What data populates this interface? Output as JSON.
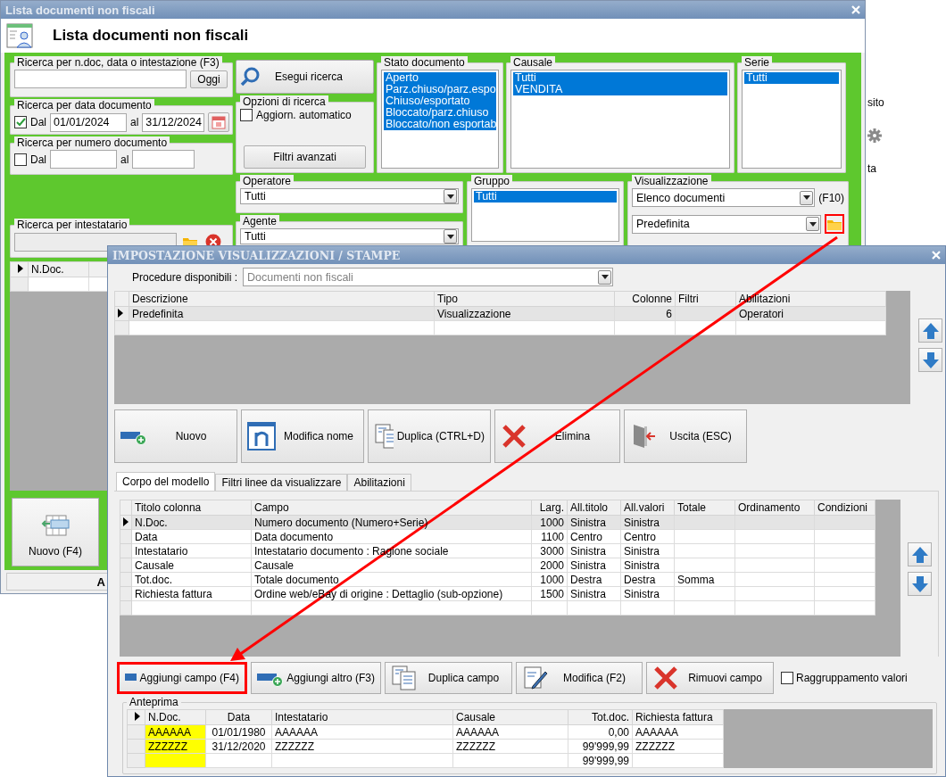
{
  "main_window": {
    "title": "Lista documenti non fiscali",
    "heading": "Lista documenti non fiscali",
    "quick_search": {
      "label": "Ricerca per n.doc, data o intestazione (F3)",
      "button": "Oggi"
    },
    "date_search": {
      "label": "Ricerca per data documento",
      "checkbox_label": "Dal",
      "checked": true,
      "from": "01/01/2024",
      "to_label": "al",
      "to": "31/12/2024"
    },
    "number_search": {
      "label": "Ricerca per numero documento",
      "checkbox_label": "Dal",
      "checked": false,
      "to_label": "al"
    },
    "holder_search": {
      "label": "Ricerca per intestatario"
    },
    "grid": {
      "columns": [
        "N.Doc."
      ]
    },
    "new_button": "Nuovo (F4)",
    "status_bar": "A",
    "run_search_button": "Esegui ricerca",
    "search_options": {
      "label": "Opzioni di ricerca",
      "auto_update_label": "Aggiorn. automatico",
      "auto_update": false,
      "advanced_button": "Filtri avanzati"
    },
    "lists": [
      {
        "label": "Stato documento",
        "items": [
          {
            "label": "Aperto",
            "selected": true
          },
          {
            "label": "Parz.chiuso/parz.espo",
            "selected": true
          },
          {
            "label": "Chiuso/esportato",
            "selected": true
          },
          {
            "label": "Bloccato/parz.chiuso",
            "selected": true
          },
          {
            "label": "Bloccato/non esportab",
            "selected": true
          }
        ]
      },
      {
        "label": "Causale",
        "items": [
          {
            "label": "Tutti",
            "selected": true
          },
          {
            "label": "VENDITA",
            "selected": true
          }
        ]
      },
      {
        "label": "Serie",
        "items": [
          {
            "label": "Tutti",
            "selected": true
          }
        ]
      }
    ],
    "operator": {
      "label": "Operatore",
      "value": "Tutti"
    },
    "agent": {
      "label": "Agente",
      "value": "Tutti"
    },
    "group": {
      "label": "Gruppo",
      "items": [
        {
          "label": "Tutti",
          "selected": true
        }
      ]
    },
    "view": {
      "label": "Visualizzazione",
      "view_value": "Elenco documenti",
      "shortcut": "(F10)",
      "layout_value": "Predefinita",
      "folder_highlighted": true
    }
  },
  "background_window": {
    "texts": [
      "sito",
      "ta"
    ]
  },
  "dialog": {
    "title": "IMPOSTAZIONE VISUALIZZAZIONI / STAMPE",
    "procedure": {
      "label": "Procedure disponibili :",
      "value": "Documenti non fiscali"
    },
    "layouts_table": {
      "columns": [
        "Descrizione",
        "Tipo",
        "Colonne",
        "Filtri",
        "Abilitazioni"
      ],
      "rows": [
        {
          "cells": [
            "Predefinita",
            "Visualizzazione",
            "6",
            null,
            "Operatori"
          ],
          "selected": true
        }
      ]
    },
    "actions": [
      {
        "label": "Nuovo",
        "kind": "add"
      },
      {
        "label": "Modifica nome",
        "kind": "rename"
      },
      {
        "label": "Duplica (CTRL+D)",
        "kind": "duplicate"
      },
      {
        "label": "Elimina",
        "kind": "delete"
      },
      {
        "label": "Uscita (ESC)",
        "kind": "exit"
      }
    ],
    "tabs": [
      {
        "label": "Corpo del modello",
        "selected": true
      },
      {
        "label": "Filtri linee da visualizzare",
        "selected": false
      },
      {
        "label": "Abilitazioni",
        "selected": false
      }
    ],
    "fields_table": {
      "columns": [
        "Titolo colonna",
        "Campo",
        "Larg.",
        "All.titolo",
        "All.valori",
        "Totale",
        "Ordinamento",
        "Condizioni"
      ],
      "rows": [
        {
          "cells": [
            "N.Doc.",
            "Numero documento (Numero+Serie)",
            "1000",
            "Sinistra",
            "Sinistra",
            null,
            null,
            null
          ],
          "selected": true
        },
        {
          "cells": [
            "Data",
            "Data documento",
            "1100",
            "Centro",
            "Centro",
            null,
            null,
            null
          ],
          "selected": false
        },
        {
          "cells": [
            "Intestatario",
            "Intestatario documento : Ragione sociale",
            "3000",
            "Sinistra",
            "Sinistra",
            null,
            null,
            null
          ],
          "selected": false
        },
        {
          "cells": [
            "Causale",
            "Causale",
            "2000",
            "Sinistra",
            "Sinistra",
            null,
            null,
            null
          ],
          "selected": false
        },
        {
          "cells": [
            "Tot.doc.",
            "Totale documento",
            "1000",
            "Destra",
            "Destra",
            "Somma",
            null,
            null
          ],
          "selected": false
        },
        {
          "cells": [
            "Richiesta fattura",
            "Ordine web/eBay di origine : Dettaglio (sub-opzione)",
            "1500",
            "Sinistra",
            "Sinistra",
            null,
            null,
            null
          ],
          "selected": false
        }
      ]
    },
    "field_buttons": [
      {
        "label": "Aggiungi campo (F4)",
        "kind": "add",
        "highlighted": true
      },
      {
        "label": "Aggiungi altro (F3)",
        "kind": "add",
        "highlighted": false
      },
      {
        "label": "Duplica campo",
        "kind": "duplicate",
        "highlighted": false
      },
      {
        "label": "Modifica (F2)",
        "kind": "edit",
        "highlighted": false
      },
      {
        "label": "Rimuovi campo",
        "kind": "delete",
        "highlighted": false
      }
    ],
    "grouping": {
      "label": "Raggruppamento valori",
      "checked": false
    },
    "preview": {
      "label": "Anteprima",
      "columns": [
        {
          "label": "N.Doc.",
          "highlighted": true
        },
        {
          "label": "Data",
          "highlighted": false
        },
        {
          "label": "Intestatario",
          "highlighted": false
        },
        {
          "label": "Causale",
          "highlighted": false
        },
        {
          "label": "Tot.doc.",
          "highlighted": false
        },
        {
          "label": "Richiesta fattura",
          "highlighted": false
        }
      ],
      "rows": [
        [
          "AAAAAA",
          "01/01/1980",
          "AAAAAA",
          "AAAAAA",
          "0,00",
          "AAAAAA"
        ],
        [
          "ZZZZZZ",
          "31/12/2020",
          "ZZZZZZ",
          "ZZZZZZ",
          "99'999,99",
          "ZZZZZZ"
        ],
        [
          null,
          null,
          null,
          null,
          "99'999,99",
          null
        ]
      ]
    }
  }
}
